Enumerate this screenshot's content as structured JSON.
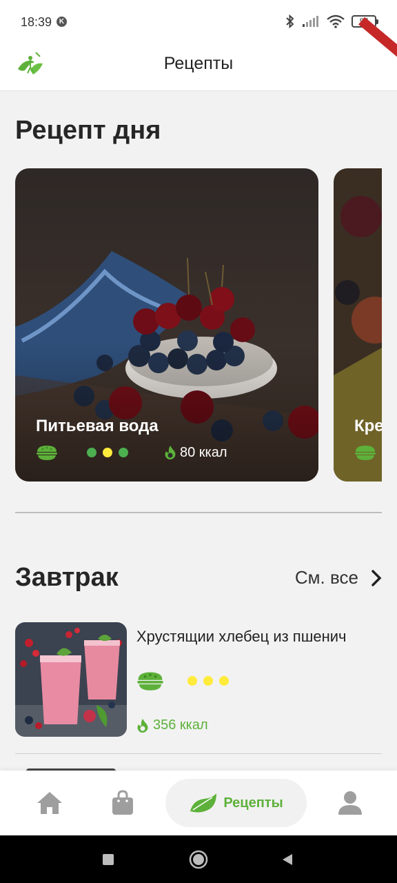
{
  "status_bar": {
    "time": "18:39",
    "battery": "97"
  },
  "app_bar": {
    "title": "Рецепты"
  },
  "recipe_of_day": {
    "title": "Рецепт дня",
    "cards": [
      {
        "name": "Питьевая вода",
        "kcal": "80 ккал"
      },
      {
        "name": "Кре"
      }
    ]
  },
  "breakfast": {
    "title": "Завтрак",
    "see_all": "См. все",
    "items": [
      {
        "name": "Хрустящии хлебец из пшенич",
        "kcal": "356 ккал"
      }
    ]
  },
  "bottom_nav": {
    "recipes_label": "Рецепты"
  },
  "colors": {
    "accent_green": "#5db13a",
    "dot_green": "#4caf50",
    "dot_yellow": "#ffeb3b",
    "ribbon_red": "#c62828"
  },
  "icons": [
    "wifi-icon",
    "bluetooth-icon",
    "signal-icon",
    "battery-icon",
    "app-logo",
    "bowl-icon",
    "flame-icon",
    "chevron-right-icon",
    "home-icon",
    "bag-icon",
    "leaf-icon",
    "person-icon"
  ]
}
